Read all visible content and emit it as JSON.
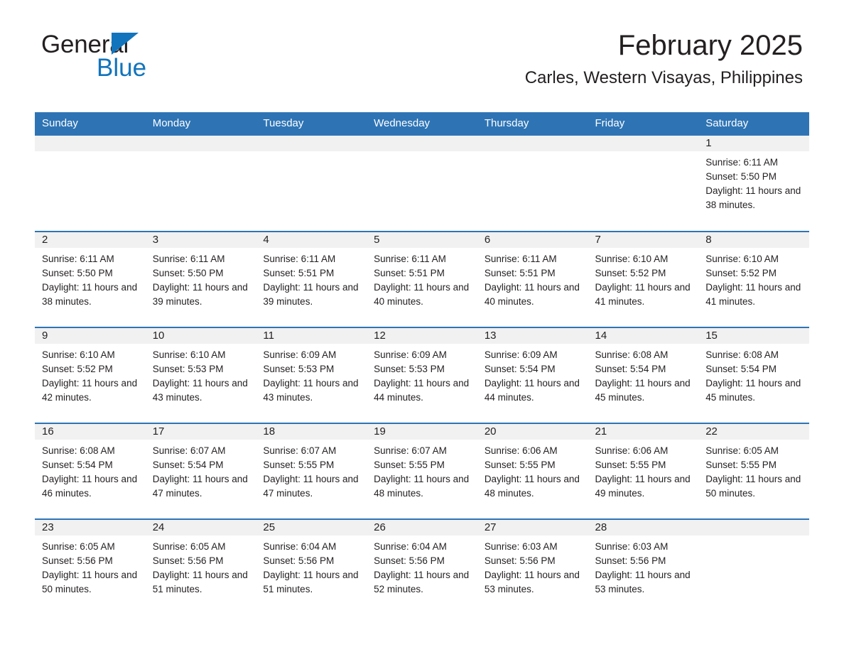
{
  "brand": {
    "name_top": "General",
    "name_bottom": "Blue",
    "triangle_color": "#1274bc",
    "text_color": "#231f20"
  },
  "header": {
    "title": "February 2025",
    "subtitle": "Carles, Western Visayas, Philippines"
  },
  "theme": {
    "header_blue": "#2e74b5",
    "daynum_band": "#f1f1f1",
    "text": "#231f20",
    "page_background": "#ffffff"
  },
  "weekdays": [
    "Sunday",
    "Monday",
    "Tuesday",
    "Wednesday",
    "Thursday",
    "Friday",
    "Saturday"
  ],
  "labels": {
    "sunrise_prefix": "Sunrise:",
    "sunset_prefix": "Sunset:",
    "daylight_prefix": "Daylight:"
  },
  "weeks": [
    [
      {
        "day": "",
        "sunrise": "",
        "sunset": "",
        "daylight": ""
      },
      {
        "day": "",
        "sunrise": "",
        "sunset": "",
        "daylight": ""
      },
      {
        "day": "",
        "sunrise": "",
        "sunset": "",
        "daylight": ""
      },
      {
        "day": "",
        "sunrise": "",
        "sunset": "",
        "daylight": ""
      },
      {
        "day": "",
        "sunrise": "",
        "sunset": "",
        "daylight": ""
      },
      {
        "day": "",
        "sunrise": "",
        "sunset": "",
        "daylight": ""
      },
      {
        "day": "1",
        "sunrise": "Sunrise: 6:11 AM",
        "sunset": "Sunset: 5:50 PM",
        "daylight": "Daylight: 11 hours and 38 minutes."
      }
    ],
    [
      {
        "day": "2",
        "sunrise": "Sunrise: 6:11 AM",
        "sunset": "Sunset: 5:50 PM",
        "daylight": "Daylight: 11 hours and 38 minutes."
      },
      {
        "day": "3",
        "sunrise": "Sunrise: 6:11 AM",
        "sunset": "Sunset: 5:50 PM",
        "daylight": "Daylight: 11 hours and 39 minutes."
      },
      {
        "day": "4",
        "sunrise": "Sunrise: 6:11 AM",
        "sunset": "Sunset: 5:51 PM",
        "daylight": "Daylight: 11 hours and 39 minutes."
      },
      {
        "day": "5",
        "sunrise": "Sunrise: 6:11 AM",
        "sunset": "Sunset: 5:51 PM",
        "daylight": "Daylight: 11 hours and 40 minutes."
      },
      {
        "day": "6",
        "sunrise": "Sunrise: 6:11 AM",
        "sunset": "Sunset: 5:51 PM",
        "daylight": "Daylight: 11 hours and 40 minutes."
      },
      {
        "day": "7",
        "sunrise": "Sunrise: 6:10 AM",
        "sunset": "Sunset: 5:52 PM",
        "daylight": "Daylight: 11 hours and 41 minutes."
      },
      {
        "day": "8",
        "sunrise": "Sunrise: 6:10 AM",
        "sunset": "Sunset: 5:52 PM",
        "daylight": "Daylight: 11 hours and 41 minutes."
      }
    ],
    [
      {
        "day": "9",
        "sunrise": "Sunrise: 6:10 AM",
        "sunset": "Sunset: 5:52 PM",
        "daylight": "Daylight: 11 hours and 42 minutes."
      },
      {
        "day": "10",
        "sunrise": "Sunrise: 6:10 AM",
        "sunset": "Sunset: 5:53 PM",
        "daylight": "Daylight: 11 hours and 43 minutes."
      },
      {
        "day": "11",
        "sunrise": "Sunrise: 6:09 AM",
        "sunset": "Sunset: 5:53 PM",
        "daylight": "Daylight: 11 hours and 43 minutes."
      },
      {
        "day": "12",
        "sunrise": "Sunrise: 6:09 AM",
        "sunset": "Sunset: 5:53 PM",
        "daylight": "Daylight: 11 hours and 44 minutes."
      },
      {
        "day": "13",
        "sunrise": "Sunrise: 6:09 AM",
        "sunset": "Sunset: 5:54 PM",
        "daylight": "Daylight: 11 hours and 44 minutes."
      },
      {
        "day": "14",
        "sunrise": "Sunrise: 6:08 AM",
        "sunset": "Sunset: 5:54 PM",
        "daylight": "Daylight: 11 hours and 45 minutes."
      },
      {
        "day": "15",
        "sunrise": "Sunrise: 6:08 AM",
        "sunset": "Sunset: 5:54 PM",
        "daylight": "Daylight: 11 hours and 45 minutes."
      }
    ],
    [
      {
        "day": "16",
        "sunrise": "Sunrise: 6:08 AM",
        "sunset": "Sunset: 5:54 PM",
        "daylight": "Daylight: 11 hours and 46 minutes."
      },
      {
        "day": "17",
        "sunrise": "Sunrise: 6:07 AM",
        "sunset": "Sunset: 5:54 PM",
        "daylight": "Daylight: 11 hours and 47 minutes."
      },
      {
        "day": "18",
        "sunrise": "Sunrise: 6:07 AM",
        "sunset": "Sunset: 5:55 PM",
        "daylight": "Daylight: 11 hours and 47 minutes."
      },
      {
        "day": "19",
        "sunrise": "Sunrise: 6:07 AM",
        "sunset": "Sunset: 5:55 PM",
        "daylight": "Daylight: 11 hours and 48 minutes."
      },
      {
        "day": "20",
        "sunrise": "Sunrise: 6:06 AM",
        "sunset": "Sunset: 5:55 PM",
        "daylight": "Daylight: 11 hours and 48 minutes."
      },
      {
        "day": "21",
        "sunrise": "Sunrise: 6:06 AM",
        "sunset": "Sunset: 5:55 PM",
        "daylight": "Daylight: 11 hours and 49 minutes."
      },
      {
        "day": "22",
        "sunrise": "Sunrise: 6:05 AM",
        "sunset": "Sunset: 5:55 PM",
        "daylight": "Daylight: 11 hours and 50 minutes."
      }
    ],
    [
      {
        "day": "23",
        "sunrise": "Sunrise: 6:05 AM",
        "sunset": "Sunset: 5:56 PM",
        "daylight": "Daylight: 11 hours and 50 minutes."
      },
      {
        "day": "24",
        "sunrise": "Sunrise: 6:05 AM",
        "sunset": "Sunset: 5:56 PM",
        "daylight": "Daylight: 11 hours and 51 minutes."
      },
      {
        "day": "25",
        "sunrise": "Sunrise: 6:04 AM",
        "sunset": "Sunset: 5:56 PM",
        "daylight": "Daylight: 11 hours and 51 minutes."
      },
      {
        "day": "26",
        "sunrise": "Sunrise: 6:04 AM",
        "sunset": "Sunset: 5:56 PM",
        "daylight": "Daylight: 11 hours and 52 minutes."
      },
      {
        "day": "27",
        "sunrise": "Sunrise: 6:03 AM",
        "sunset": "Sunset: 5:56 PM",
        "daylight": "Daylight: 11 hours and 53 minutes."
      },
      {
        "day": "28",
        "sunrise": "Sunrise: 6:03 AM",
        "sunset": "Sunset: 5:56 PM",
        "daylight": "Daylight: 11 hours and 53 minutes."
      },
      {
        "day": "",
        "sunrise": "",
        "sunset": "",
        "daylight": ""
      }
    ]
  ]
}
